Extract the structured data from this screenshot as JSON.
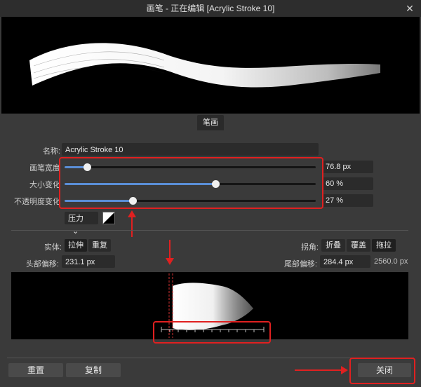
{
  "window": {
    "title": "画笔 - 正在编辑 [Acrylic Stroke 10]",
    "close_glyph": "✕"
  },
  "tabs": [
    {
      "label": "笔画"
    }
  ],
  "form": {
    "name_label": "名称:",
    "name_value": "Acrylic Stroke 10",
    "sliders": [
      {
        "label": "画笔宽度",
        "value_text": "76.8 px",
        "fraction": 0.09
      },
      {
        "label": "大小变化",
        "value_text": "60 %",
        "fraction": 0.6
      },
      {
        "label": "不透明度变化",
        "value_text": "27 %",
        "fraction": 0.27
      }
    ],
    "pressure_label": "压力",
    "pressure_chevron": "⌄"
  },
  "stretch": {
    "label": "实体:",
    "options": [
      "拉伸",
      "重复"
    ],
    "selected": "拉伸"
  },
  "corner": {
    "label": "拐角:",
    "options": [
      "折叠",
      "覆盖",
      "拖拉"
    ],
    "selected": "拖拉"
  },
  "offsets": {
    "head_label": "头部偏移:",
    "head_value": "231.1 px",
    "tail_label": "尾部偏移:",
    "tail_value": "284.4 px",
    "total": "2560.0 px"
  },
  "footer": {
    "reset_label": "重置",
    "copy_label": "复制",
    "close_label": "关闭"
  },
  "colors": {
    "accent": "#5a8ed6",
    "annotation": "#e02020"
  }
}
